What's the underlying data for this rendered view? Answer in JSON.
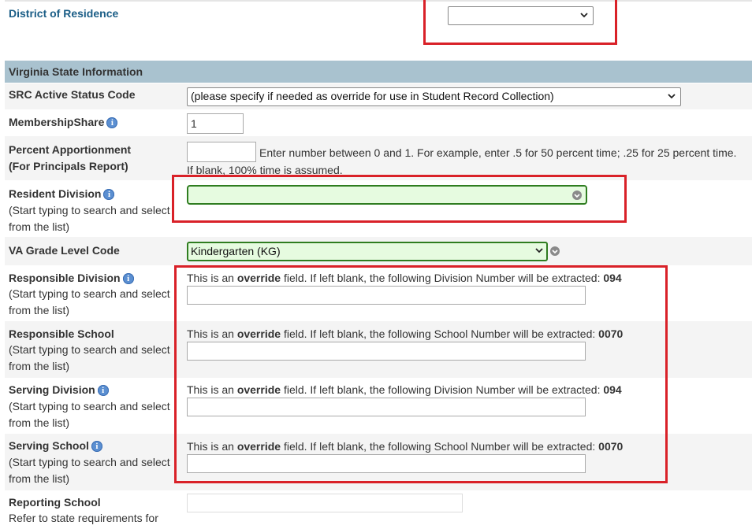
{
  "district_of_residence": {
    "label": "District of Residence",
    "value": ""
  },
  "section_header": "Virginia State Information",
  "src_active_status": {
    "label": "SRC Active Status Code",
    "value": "(please specify if needed as override for use in Student Record Collection)"
  },
  "membership_share": {
    "label": "MembershipShare",
    "value": "1"
  },
  "percent_apportionment": {
    "label_line1": "Percent Apportionment",
    "label_line2": "(For Principals Report)",
    "value": "",
    "help_line1": "Enter number between 0 and 1. For example, enter .5 for 50 percent time; .25 for 25 percent time.",
    "help_line2": "If blank, 100% time is assumed."
  },
  "resident_division": {
    "label": "Resident Division",
    "hint1": "(Start typing to search and select",
    "hint2": "from the list)",
    "value": ""
  },
  "va_grade_level": {
    "label": "VA Grade Level Code",
    "value": "Kindergarten (KG)"
  },
  "override": {
    "prefix": "This is an ",
    "bold": "override",
    "division_mid": " field. If left blank, the following Division Number will be extracted: ",
    "school_mid": " field. If left blank, the following School Number will be extracted: ",
    "division_number": "094",
    "school_number": "0070"
  },
  "responsible_division": {
    "label": "Responsible Division",
    "hint1": "(Start typing to search and select",
    "hint2": "from the list)",
    "value": ""
  },
  "responsible_school": {
    "label": "Responsible School",
    "hint1": "(Start typing to search and select",
    "hint2": "from the list)",
    "value": ""
  },
  "serving_division": {
    "label": "Serving Division",
    "hint1": "(Start typing to search and select",
    "hint2": "from the list)",
    "value": ""
  },
  "serving_school": {
    "label": "Serving School",
    "hint1": "(Start typing to search and select",
    "hint2": "from the list)",
    "value": ""
  },
  "reporting_school": {
    "label": "Reporting School",
    "hint1": "Refer to state requirements for",
    "value": ""
  },
  "colors": {
    "header_bg": "#a9c2cf",
    "highlight_red": "#d92128",
    "green_field": "#e6fbe0",
    "green_border": "#2f7d20",
    "label_blue": "#1a5d86"
  }
}
